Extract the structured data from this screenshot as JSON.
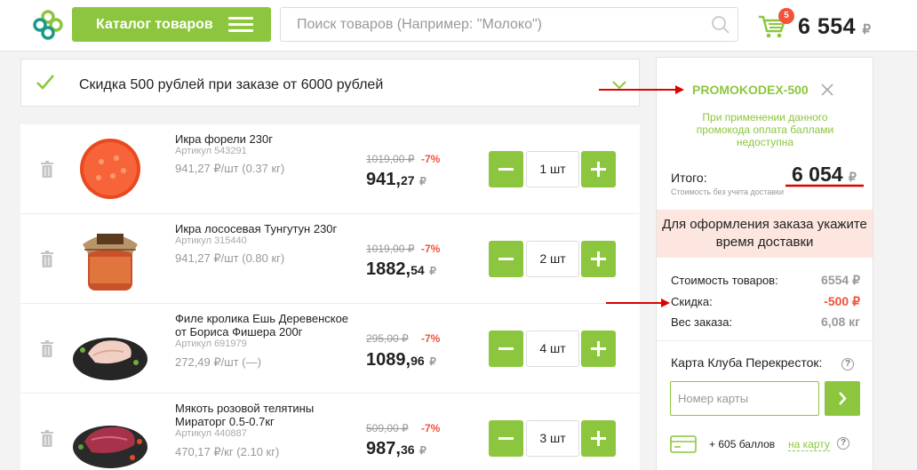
{
  "header": {
    "catalog_label": "Каталог товаров",
    "search_placeholder": "Поиск товаров (Например: \"Молоко\")",
    "cart_badge": "5",
    "cart_total": "6 554",
    "currency": "₽"
  },
  "promo_banner": {
    "text": "Скидка 500 рублей при заказе от 6000 рублей"
  },
  "items": [
    {
      "name": "Икра форели 230г",
      "sku": "Артикул 543291",
      "unit_price": "941,27 ₽/шт (0.37 кг)",
      "old_price": "1019,00 ₽",
      "discount": "-7%",
      "price_main": "941,",
      "price_kop": "27",
      "quantity": "1 шт"
    },
    {
      "name": "Икра лососевая Тунгутун 230г",
      "sku": "Артикул 315440",
      "unit_price": "941,27 ₽/шт (0.80 кг)",
      "old_price": "1019,00 ₽",
      "discount": "-7%",
      "price_main": "1882,",
      "price_kop": "54",
      "quantity": "2 шт"
    },
    {
      "name": "Филе кролика Ешь Деревенское от Бориса Фишера 200г",
      "sku": "Артикул 691979",
      "unit_price": "272,49 ₽/шт (—)",
      "old_price": "295,00 ₽",
      "discount": "-7%",
      "price_main": "1089,",
      "price_kop": "96",
      "quantity": "4 шт"
    },
    {
      "name": "Мякоть розовой телятины Мираторг 0.5-0.7кг",
      "sku": "Артикул 440887",
      "unit_price": "470,17 ₽/кг (2.10 кг)",
      "old_price": "509,00 ₽",
      "discount": "-7%",
      "price_main": "987,",
      "price_kop": "36",
      "quantity": "3 шт"
    }
  ],
  "sidebar": {
    "promo_code": "PROMOKODEX-500",
    "promo_note": "При применении данного промокода оплата баллами недоступна",
    "total_label": "Итого:",
    "total_value": "6 054",
    "total_note": "Стоимость без учета доставки",
    "warning": "Для оформления заказа укажите время доставки",
    "rows": [
      {
        "label": "Стоимость товаров:",
        "value": "6554 ₽"
      },
      {
        "label": "Скидка:",
        "value": "-500 ₽"
      },
      {
        "label": "Вес заказа:",
        "value": "6,08 кг"
      }
    ],
    "club_title": "Карта Клуба Перекресток:",
    "card_placeholder": "Номер карты",
    "points_text": "+ 605 баллов",
    "points_link": "на карту",
    "help": "?"
  },
  "colors": {
    "brand_green": "#8cc63f",
    "discount_red": "#f0533a",
    "warning_bg": "#fde6e0",
    "annotation_red": "#e00000"
  }
}
